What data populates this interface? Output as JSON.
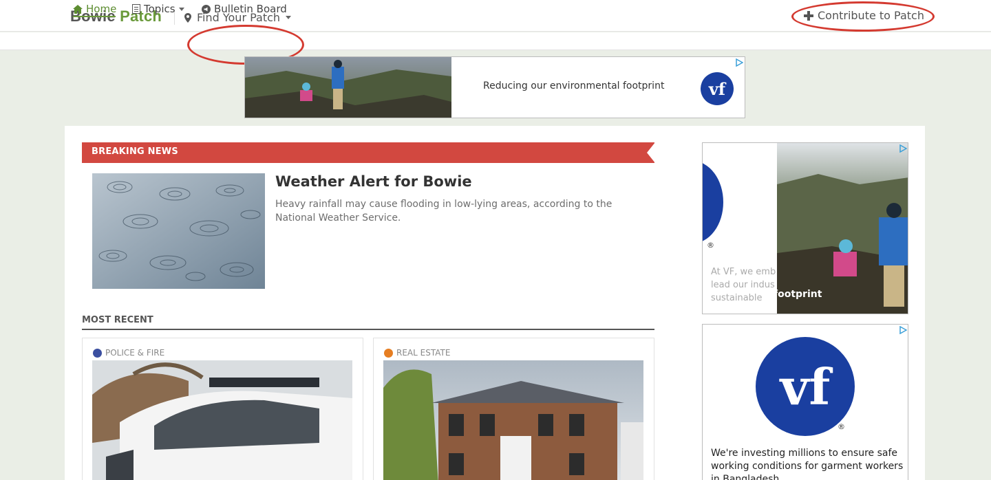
{
  "header": {
    "brand_part1": "Bowie",
    "brand_part2": "Patch",
    "find_patch": "Find Your Patch",
    "contribute": "Contribute to Patch"
  },
  "nav": {
    "home": "Home",
    "topics": "Topics",
    "bulletin": "Bulletin Board"
  },
  "ads": {
    "top_text": "Reducing our environmental footprint",
    "side1_text": "At VF, we emb... lead our indus... sustainable footprint",
    "side1_lines": [
      "At VF, we emb",
      "lead our indus",
      "sustainable"
    ],
    "side1_overlay": "footprint",
    "side2_text": "We're investing millions to ensure safe working conditions for garment workers in Bangladesh",
    "logo_text": "vf"
  },
  "breaking": {
    "label": "BREAKING NEWS",
    "headline": "Weather Alert for Bowie",
    "summary": "Heavy rainfall may cause flooding in low-lying areas, according to the National Weather Service."
  },
  "most_recent": {
    "label": "MOST RECENT",
    "cards": [
      {
        "category": "POLICE & FIRE",
        "color": "#3b4fa0"
      },
      {
        "category": "REAL ESTATE",
        "color": "#e67e22"
      }
    ]
  },
  "colors": {
    "brand_green": "#6a9a3b",
    "breaking_red": "#d24840",
    "annotation_red": "#d43a30",
    "vf_blue": "#1a3fa0"
  }
}
